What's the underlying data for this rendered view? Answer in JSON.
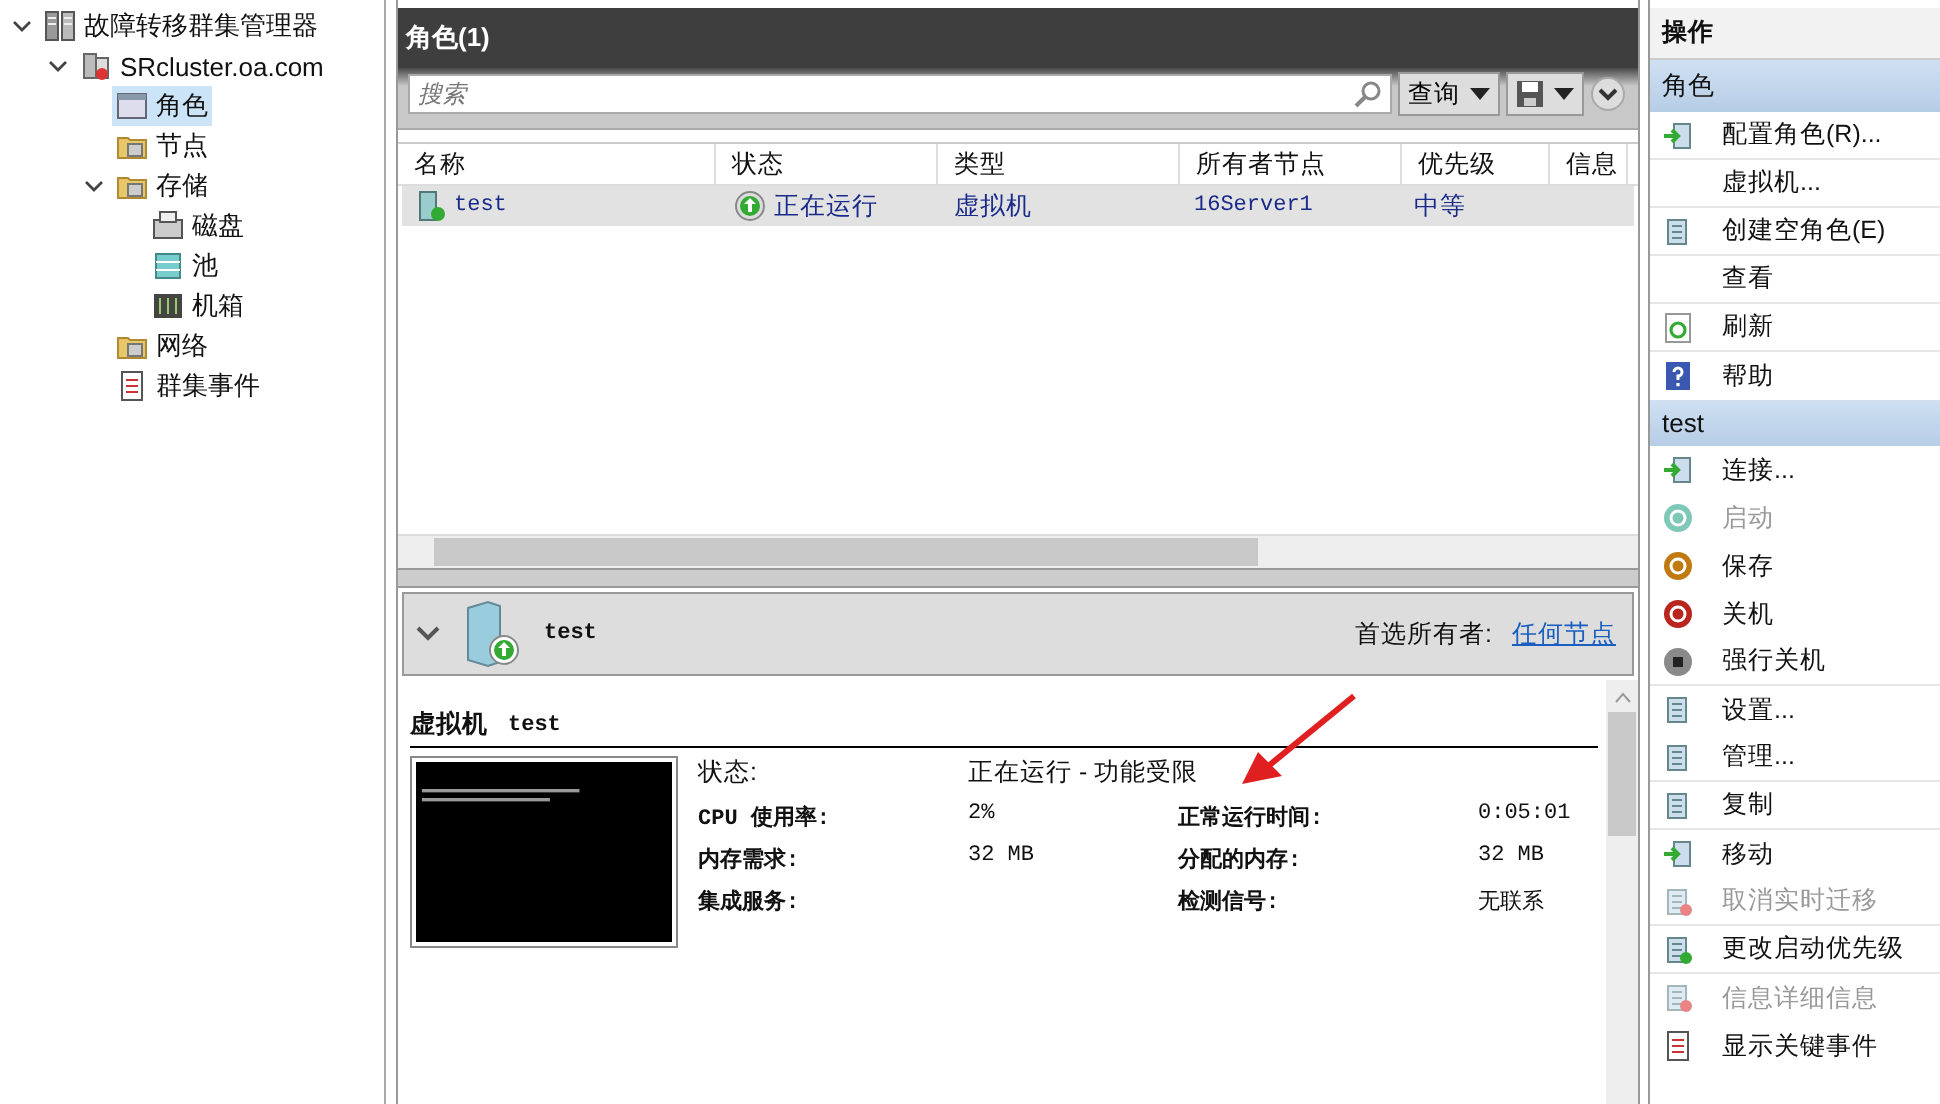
{
  "tree": [
    {
      "label": "故障转移群集管理器",
      "kind": "manager",
      "expanded": true,
      "selected": false,
      "children": [
        {
          "label": "SRcluster.oa.com",
          "kind": "cluster",
          "expanded": true,
          "selected": false,
          "children": [
            {
              "label": "角色",
              "kind": "roles",
              "selected": true
            },
            {
              "label": "节点",
              "kind": "nodes",
              "selected": false
            },
            {
              "label": "存储",
              "kind": "storage",
              "expanded": true,
              "selected": false,
              "children": [
                {
                  "label": "磁盘",
                  "kind": "disk",
                  "selected": false
                },
                {
                  "label": "池",
                  "kind": "pool",
                  "selected": false
                },
                {
                  "label": "机箱",
                  "kind": "enclosure",
                  "selected": false
                }
              ]
            },
            {
              "label": "网络",
              "kind": "network",
              "selected": false
            },
            {
              "label": "群集事件",
              "kind": "events",
              "selected": false
            }
          ]
        }
      ]
    }
  ],
  "roles": {
    "title": "角色(1)",
    "search": {
      "placeholder": "搜索"
    },
    "query_button": "查询",
    "columns": [
      "名称",
      "状态",
      "类型",
      "所有者节点",
      "优先级",
      "信息"
    ],
    "rows": [
      {
        "name": "test",
        "status": "正在运行",
        "type": "虚拟机",
        "owner": "16Server1",
        "priority": "中等",
        "selected": true
      }
    ]
  },
  "details": {
    "name": "test",
    "preferred_owners_label": "首选所有者:",
    "preferred_owners_link": "任何节点",
    "heading_kind": "虚拟机",
    "heading_name": "test",
    "status_label": "状态:",
    "status_value": "正在运行 - 功能受限",
    "fields": [
      {
        "label": "CPU 使用率:",
        "value": "2%",
        "label2": "正常运行时间:",
        "value2": "0:05:01"
      },
      {
        "label": "内存需求:",
        "value": "32 MB",
        "label2": "分配的内存:",
        "value2": "32 MB"
      },
      {
        "label": "集成服务:",
        "label2": "检测信号:",
        "value2": "无联系"
      }
    ]
  },
  "actions": {
    "title": "操作",
    "sections": [
      {
        "title": "角色",
        "items": [
          {
            "label": "配置角色(R)...",
            "kind": "configure",
            "disabled": false,
            "separator": true
          },
          {
            "label": "虚拟机...",
            "kind": "none",
            "disabled": false,
            "separator": true
          },
          {
            "label": "创建空角色(E)",
            "kind": "create",
            "disabled": false,
            "separator": true
          },
          {
            "label": "查看",
            "kind": "none",
            "disabled": false,
            "separator": true
          },
          {
            "label": "刷新",
            "kind": "refresh",
            "disabled": false,
            "separator": true
          },
          {
            "label": "帮助",
            "kind": "help",
            "disabled": false,
            "separator": false
          }
        ]
      },
      {
        "title": "test",
        "items": [
          {
            "label": "连接...",
            "kind": "connect",
            "disabled": false,
            "separator": false
          },
          {
            "label": "启动",
            "kind": "start",
            "disabled": true,
            "separator": false
          },
          {
            "label": "保存",
            "kind": "save",
            "disabled": false,
            "separator": false
          },
          {
            "label": "关机",
            "kind": "shutdown",
            "disabled": false,
            "separator": false
          },
          {
            "label": "强行关机",
            "kind": "stop",
            "disabled": false,
            "separator": true
          },
          {
            "label": "设置...",
            "kind": "settings",
            "disabled": false,
            "separator": false
          },
          {
            "label": "管理...",
            "kind": "manage",
            "disabled": false,
            "separator": true
          },
          {
            "label": "复制",
            "kind": "replicate",
            "disabled": false,
            "separator": true
          },
          {
            "label": "移动",
            "kind": "move",
            "disabled": false,
            "separator": false
          },
          {
            "label": "取消实时迁移",
            "kind": "cancel",
            "disabled": true,
            "separator": true
          },
          {
            "label": "更改启动优先级",
            "kind": "priority",
            "disabled": false,
            "separator": true
          },
          {
            "label": "信息详细信息",
            "kind": "info",
            "disabled": true,
            "separator": false
          },
          {
            "label": "显示关键事件",
            "kind": "events",
            "disabled": false,
            "separator": false
          }
        ]
      }
    ]
  }
}
